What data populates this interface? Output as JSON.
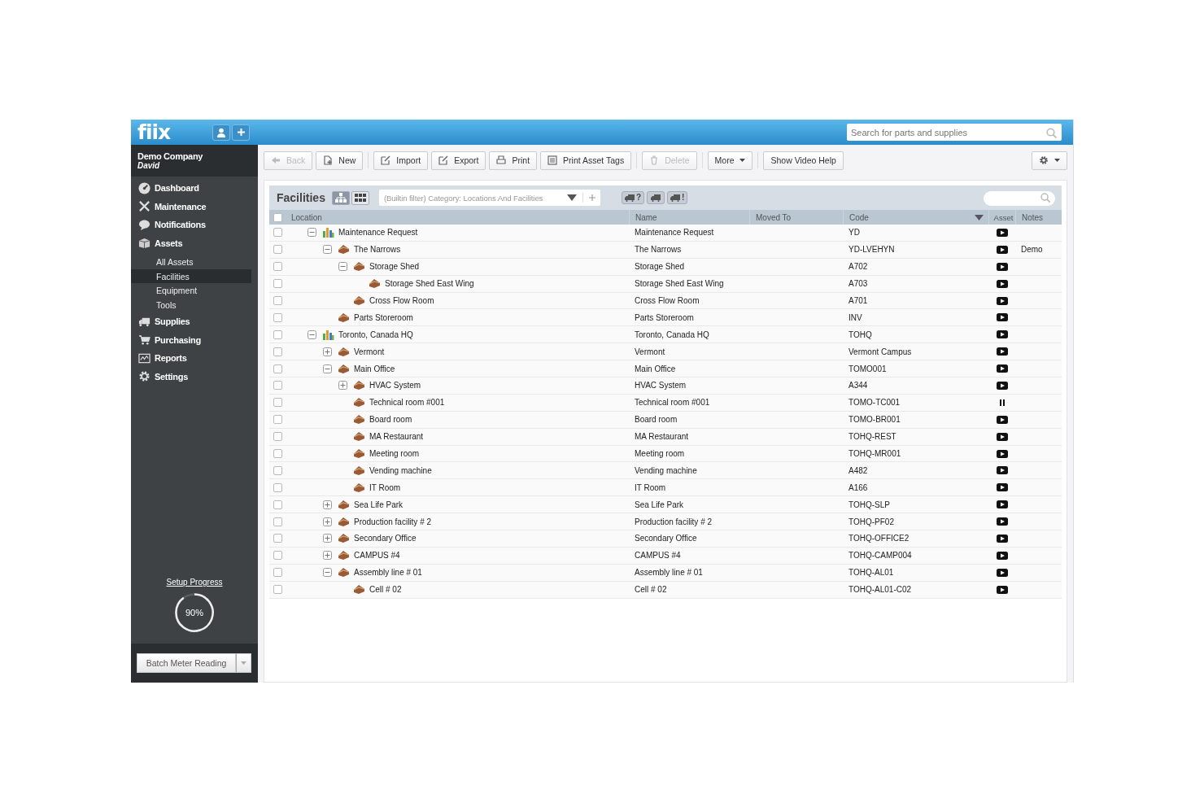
{
  "topbar": {
    "logo": "fiix",
    "search": {
      "placeholder": "Search for parts and supplies"
    }
  },
  "sidebar": {
    "company": "Demo Company",
    "user": "David",
    "items": [
      {
        "label": "Dashboard",
        "kind": "dashboard",
        "selected": false
      },
      {
        "label": "Maintenance",
        "kind": "maintenance",
        "selected": false
      },
      {
        "label": "Notifications",
        "kind": "notifications",
        "selected": false
      },
      {
        "label": "Assets",
        "kind": "assets",
        "selected": false,
        "children": [
          {
            "label": "All Assets",
            "selected": false
          },
          {
            "label": "Facilities",
            "selected": true
          },
          {
            "label": "Equipment",
            "selected": false
          },
          {
            "label": "Tools",
            "selected": false
          }
        ]
      },
      {
        "label": "Supplies",
        "kind": "supplies",
        "selected": false
      },
      {
        "label": "Purchasing",
        "kind": "purchasing",
        "selected": false
      },
      {
        "label": "Reports",
        "kind": "reports",
        "selected": false
      },
      {
        "label": "Settings",
        "kind": "settings",
        "selected": false
      }
    ],
    "setup_progress": {
      "label": "Setup Progress",
      "level": 0.9,
      "reading": "90%"
    },
    "batch_button": "Batch Meter Reading"
  },
  "toolbar": [
    {
      "kind": "back",
      "label": "Back",
      "disabled": true
    },
    {
      "kind": "new",
      "label": "New",
      "disabled": false
    },
    {
      "kind": "import",
      "label": "Import",
      "disabled": false
    },
    {
      "kind": "export",
      "label": "Export",
      "disabled": false
    },
    {
      "kind": "print",
      "label": "Print",
      "disabled": false
    },
    {
      "kind": "tags",
      "label": "Print Asset Tags",
      "disabled": false
    },
    {
      "kind": "delete",
      "label": "Delete",
      "disabled": true
    },
    {
      "kind": "more",
      "label": "More",
      "disabled": false
    },
    {
      "kind": "help",
      "label": "Show Video Help",
      "disabled": false
    },
    {
      "kind": "gear",
      "disabled": false
    }
  ],
  "panel": {
    "title": "Facilities",
    "views": [
      {
        "kind": "tree",
        "selected": true
      },
      {
        "kind": "grid",
        "selected": false
      }
    ],
    "filter": "(Builtin filter) Category: Locations And Facilities",
    "truck_buttons": [
      {
        "kind": "question",
        "label": "?"
      },
      {
        "kind": "plain"
      },
      {
        "kind": "alert",
        "label": "!"
      }
    ]
  },
  "table": {
    "select_all": {
      "checked": false
    },
    "columns": [
      {
        "label": "Location"
      },
      {
        "label": "Name"
      },
      {
        "label": "Moved To"
      },
      {
        "label": "Code",
        "menu": true
      },
      {
        "label": "Asset"
      },
      {
        "label": "Notes"
      }
    ],
    "rows": [
      {
        "location": "Maintenance Request",
        "kind": "site",
        "expanded": true,
        "checked": false,
        "name": "Maintenance Request",
        "code": "YD",
        "asset": {
          "kind": "play"
        },
        "children": [
          {
            "location": "The Narrows",
            "kind": "building",
            "expanded": true,
            "checked": false,
            "name": "The Narrows",
            "code": "YD-LVEHYN",
            "asset": {
              "kind": "play"
            },
            "notes": "Demo",
            "children": [
              {
                "location": "Storage Shed",
                "kind": "building",
                "expanded": true,
                "checked": false,
                "name": "Storage Shed",
                "code": "A702",
                "asset": {
                  "kind": "play"
                },
                "children": [
                  {
                    "location": "Storage Shed East Wing",
                    "kind": "building",
                    "checked": false,
                    "name": "Storage Shed East Wing",
                    "code": "A703",
                    "asset": {
                      "kind": "play"
                    }
                  }
                ]
              },
              {
                "location": "Cross Flow Room",
                "kind": "building",
                "checked": false,
                "name": "Cross Flow Room",
                "code": "A701",
                "asset": {
                  "kind": "play"
                }
              }
            ]
          },
          {
            "location": "Parts Storeroom",
            "kind": "building",
            "checked": false,
            "name": "Parts Storeroom",
            "code": "INV",
            "asset": {
              "kind": "play"
            }
          }
        ]
      },
      {
        "location": "Toronto, Canada HQ",
        "kind": "site",
        "expanded": true,
        "checked": false,
        "name": "Toronto, Canada HQ",
        "code": "TOHQ",
        "asset": {
          "kind": "play"
        },
        "children": [
          {
            "location": "Vermont",
            "kind": "building",
            "expanded": false,
            "checked": false,
            "name": "Vermont",
            "code": "Vermont Campus",
            "asset": {
              "kind": "play"
            }
          },
          {
            "location": "Main Office",
            "kind": "building",
            "expanded": true,
            "checked": false,
            "name": "Main Office",
            "code": "TOMO001",
            "asset": {
              "kind": "play"
            },
            "children": [
              {
                "location": "HVAC System",
                "kind": "building",
                "expanded": false,
                "checked": false,
                "name": "HVAC System",
                "code": "A344",
                "asset": {
                  "kind": "play"
                }
              },
              {
                "location": "Technical room #001",
                "kind": "building",
                "checked": false,
                "name": "Technical room #001",
                "code": "TOMO-TC001",
                "asset": {
                  "kind": "pause"
                }
              },
              {
                "location": "Board room",
                "kind": "building",
                "checked": false,
                "name": "Board room",
                "code": "TOMO-BR001",
                "asset": {
                  "kind": "play"
                }
              },
              {
                "location": "MA Restaurant",
                "kind": "building",
                "checked": false,
                "name": "MA Restaurant",
                "code": "TOHQ-REST",
                "asset": {
                  "kind": "play"
                }
              },
              {
                "location": "Meeting room",
                "kind": "building",
                "checked": false,
                "name": "Meeting room",
                "code": "TOHQ-MR001",
                "asset": {
                  "kind": "play"
                }
              },
              {
                "location": "Vending machine",
                "kind": "building",
                "checked": false,
                "name": "Vending machine",
                "code": "A482",
                "asset": {
                  "kind": "play"
                }
              },
              {
                "location": "IT Room",
                "kind": "building",
                "checked": false,
                "name": "IT Room",
                "code": "A166",
                "asset": {
                  "kind": "play"
                }
              }
            ]
          },
          {
            "location": "Sea Life Park",
            "kind": "building",
            "expanded": false,
            "checked": false,
            "name": "Sea Life Park",
            "code": "TOHQ-SLP",
            "asset": {
              "kind": "play"
            }
          },
          {
            "location": "Production facility # 2",
            "kind": "building",
            "expanded": false,
            "checked": false,
            "name": "Production facility # 2",
            "code": "TOHQ-PF02",
            "asset": {
              "kind": "play"
            }
          },
          {
            "location": "Secondary Office",
            "kind": "building",
            "expanded": false,
            "checked": false,
            "name": "Secondary Office",
            "code": "TOHQ-OFFICE2",
            "asset": {
              "kind": "play"
            }
          },
          {
            "location": "CAMPUS #4",
            "kind": "building",
            "expanded": false,
            "checked": false,
            "name": "CAMPUS #4",
            "code": "TOHQ-CAMP004",
            "asset": {
              "kind": "play"
            }
          },
          {
            "location": "Assembly line # 01",
            "kind": "building",
            "expanded": true,
            "checked": false,
            "name": "Assembly line # 01",
            "code": "TOHQ-AL01",
            "asset": {
              "kind": "play"
            },
            "children": [
              {
                "location": "Cell # 02",
                "kind": "building",
                "checked": false,
                "name": "Cell # 02",
                "code": "TOHQ-AL01-C02",
                "asset": {
                  "kind": "play"
                }
              }
            ]
          }
        ]
      }
    ]
  }
}
